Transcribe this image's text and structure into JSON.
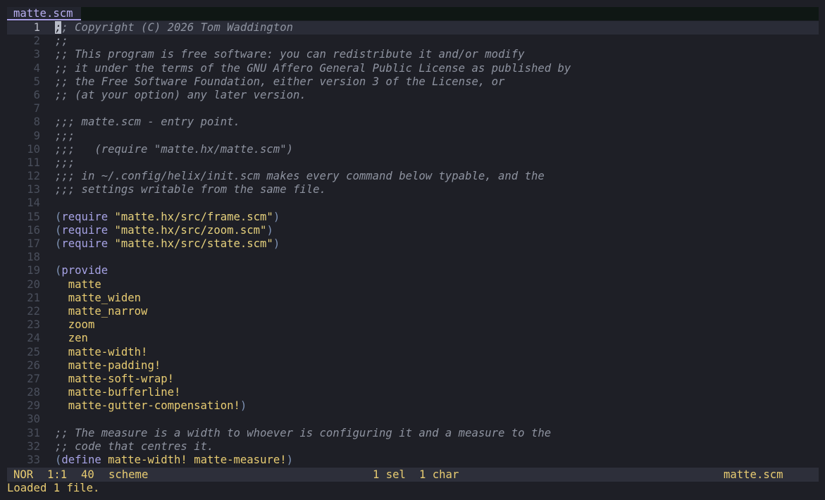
{
  "bufferline": {
    "active_tab": "matte.scm"
  },
  "editor": {
    "lines": [
      {
        "n": "1",
        "tokens": [
          {
            "t": "cursor",
            "v": ";"
          },
          {
            "t": "comment",
            "v": "; Copyright (C) 2026 Tom Waddington"
          }
        ]
      },
      {
        "n": "2",
        "tokens": [
          {
            "t": "comment",
            "v": ";;"
          }
        ]
      },
      {
        "n": "3",
        "tokens": [
          {
            "t": "comment",
            "v": ";; This program is free software: you can redistribute it and/or modify"
          }
        ]
      },
      {
        "n": "4",
        "tokens": [
          {
            "t": "comment",
            "v": ";; it under the terms of the GNU Affero General Public License as published by"
          }
        ]
      },
      {
        "n": "5",
        "tokens": [
          {
            "t": "comment",
            "v": ";; the Free Software Foundation, either version 3 of the License, or"
          }
        ]
      },
      {
        "n": "6",
        "tokens": [
          {
            "t": "comment",
            "v": ";; (at your option) any later version."
          }
        ]
      },
      {
        "n": "7",
        "tokens": []
      },
      {
        "n": "8",
        "tokens": [
          {
            "t": "comment",
            "v": ";;; matte.scm - entry point."
          }
        ]
      },
      {
        "n": "9",
        "tokens": [
          {
            "t": "comment",
            "v": ";;;"
          }
        ]
      },
      {
        "n": "10",
        "tokens": [
          {
            "t": "comment",
            "v": ";;;   (require \"matte.hx/matte.scm\")"
          }
        ]
      },
      {
        "n": "11",
        "tokens": [
          {
            "t": "comment",
            "v": ";;;"
          }
        ]
      },
      {
        "n": "12",
        "tokens": [
          {
            "t": "comment",
            "v": ";;; in ~/.config/helix/init.scm makes every command below typable, and the"
          }
        ]
      },
      {
        "n": "13",
        "tokens": [
          {
            "t": "comment",
            "v": ";;; settings writable from the same file."
          }
        ]
      },
      {
        "n": "14",
        "tokens": []
      },
      {
        "n": "15",
        "tokens": [
          {
            "t": "punc",
            "v": "("
          },
          {
            "t": "kw",
            "v": "require"
          },
          {
            "t": "plain",
            "v": " "
          },
          {
            "t": "str",
            "v": "\"matte.hx/src/frame.scm\""
          },
          {
            "t": "punc",
            "v": ")"
          }
        ]
      },
      {
        "n": "16",
        "tokens": [
          {
            "t": "punc",
            "v": "("
          },
          {
            "t": "kw",
            "v": "require"
          },
          {
            "t": "plain",
            "v": " "
          },
          {
            "t": "str",
            "v": "\"matte.hx/src/zoom.scm\""
          },
          {
            "t": "punc",
            "v": ")"
          }
        ]
      },
      {
        "n": "17",
        "tokens": [
          {
            "t": "punc",
            "v": "("
          },
          {
            "t": "kw",
            "v": "require"
          },
          {
            "t": "plain",
            "v": " "
          },
          {
            "t": "str",
            "v": "\"matte.hx/src/state.scm\""
          },
          {
            "t": "punc",
            "v": ")"
          }
        ]
      },
      {
        "n": "18",
        "tokens": []
      },
      {
        "n": "19",
        "tokens": [
          {
            "t": "punc",
            "v": "("
          },
          {
            "t": "kw",
            "v": "provide"
          }
        ]
      },
      {
        "n": "20",
        "tokens": [
          {
            "t": "plain",
            "v": "  "
          },
          {
            "t": "sym",
            "v": "matte"
          }
        ]
      },
      {
        "n": "21",
        "tokens": [
          {
            "t": "plain",
            "v": "  "
          },
          {
            "t": "sym",
            "v": "matte_widen"
          }
        ]
      },
      {
        "n": "22",
        "tokens": [
          {
            "t": "plain",
            "v": "  "
          },
          {
            "t": "sym",
            "v": "matte_narrow"
          }
        ]
      },
      {
        "n": "23",
        "tokens": [
          {
            "t": "plain",
            "v": "  "
          },
          {
            "t": "sym",
            "v": "zoom"
          }
        ]
      },
      {
        "n": "24",
        "tokens": [
          {
            "t": "plain",
            "v": "  "
          },
          {
            "t": "sym",
            "v": "zen"
          }
        ]
      },
      {
        "n": "25",
        "tokens": [
          {
            "t": "plain",
            "v": "  "
          },
          {
            "t": "sym",
            "v": "matte-width!"
          }
        ]
      },
      {
        "n": "26",
        "tokens": [
          {
            "t": "plain",
            "v": "  "
          },
          {
            "t": "sym",
            "v": "matte-padding!"
          }
        ]
      },
      {
        "n": "27",
        "tokens": [
          {
            "t": "plain",
            "v": "  "
          },
          {
            "t": "sym",
            "v": "matte-soft-wrap!"
          }
        ]
      },
      {
        "n": "28",
        "tokens": [
          {
            "t": "plain",
            "v": "  "
          },
          {
            "t": "sym",
            "v": "matte-bufferline!"
          }
        ]
      },
      {
        "n": "29",
        "tokens": [
          {
            "t": "plain",
            "v": "  "
          },
          {
            "t": "sym",
            "v": "matte-gutter-compensation!"
          },
          {
            "t": "punc",
            "v": ")"
          }
        ]
      },
      {
        "n": "30",
        "tokens": []
      },
      {
        "n": "31",
        "tokens": [
          {
            "t": "comment",
            "v": ";; The measure is a width to whoever is configuring it and a measure to the"
          }
        ]
      },
      {
        "n": "32",
        "tokens": [
          {
            "t": "comment",
            "v": ";; code that centres it."
          }
        ]
      },
      {
        "n": "33",
        "tokens": [
          {
            "t": "punc",
            "v": "("
          },
          {
            "t": "kw",
            "v": "define"
          },
          {
            "t": "plain",
            "v": " "
          },
          {
            "t": "sym",
            "v": "matte-width!"
          },
          {
            "t": "plain",
            "v": " "
          },
          {
            "t": "sym",
            "v": "matte-measure!"
          },
          {
            "t": "punc",
            "v": ")"
          }
        ]
      }
    ]
  },
  "statusline": {
    "mode": "NOR",
    "position": "1:1",
    "line_count": "40",
    "language": "scheme",
    "selections": "1 sel",
    "chars": "1 char",
    "file": "matte.scm"
  },
  "message": "Loaded 1 file.",
  "colors": {
    "background": "#1e1f26",
    "comment": "#8e93a0",
    "keyword": "#a7a3e5",
    "string": "#e6d17d",
    "symbol": "#e8cc72",
    "statusline": "#2d2f3a",
    "tab_accent": "#a89ee6"
  }
}
